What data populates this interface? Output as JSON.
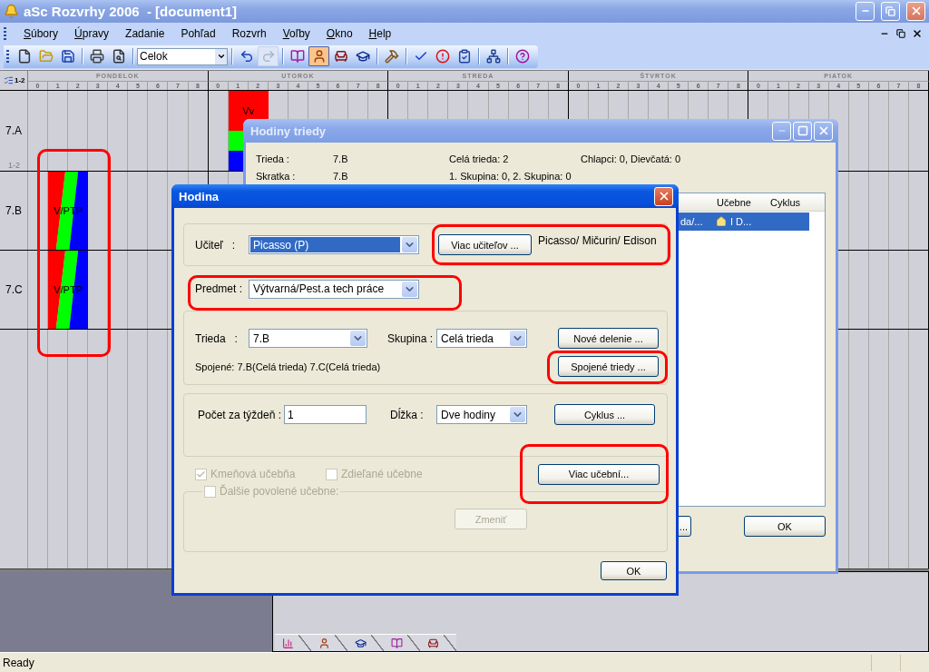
{
  "window": {
    "title": "aSc Rozvrhy 2006  - [document1]"
  },
  "menu": [
    {
      "label": "Súbory",
      "underlined": true
    },
    {
      "label": "Úpravy",
      "underlined": true
    },
    {
      "label": "Zadanie",
      "underlined": false
    },
    {
      "label": "Pohľad",
      "underlined": false
    },
    {
      "label": "Rozvrh",
      "underlined": false
    },
    {
      "label": "Voľby",
      "underlined": true
    },
    {
      "label": "Okno",
      "underlined": true
    },
    {
      "label": "Help",
      "underlined": true
    }
  ],
  "toolbar": {
    "view_select": "Celok",
    "buttons": [
      {
        "pressed": false,
        "disabled": false
      },
      {
        "pressed": false,
        "disabled": false
      },
      {
        "pressed": false,
        "disabled": false
      },
      {
        "pressed": false,
        "disabled": false
      },
      {
        "pressed": false,
        "disabled": false
      },
      {
        "pressed": false,
        "disabled": false
      },
      {
        "pressed": false,
        "disabled": true
      },
      {
        "pressed": false,
        "disabled": false
      },
      {
        "pressed": true,
        "disabled": false
      },
      {
        "pressed": false,
        "disabled": false
      },
      {
        "pressed": false,
        "disabled": false
      },
      {
        "pressed": false,
        "disabled": false
      },
      {
        "pressed": false,
        "disabled": false
      },
      {
        "pressed": false,
        "disabled": false
      },
      {
        "pressed": false,
        "disabled": false
      },
      {
        "pressed": false,
        "disabled": false
      },
      {
        "pressed": false,
        "disabled": false
      }
    ]
  },
  "timetable": {
    "corner_label": "1-2",
    "highlighted": true,
    "days": [
      {
        "name": "PONDELOK",
        "periods": [
          "0",
          "1",
          "2",
          "3",
          "4",
          "5",
          "6",
          "7",
          "8"
        ]
      },
      {
        "name": "UTOROK",
        "periods": [
          "0",
          "1",
          "2",
          "3",
          "4",
          "5",
          "6",
          "7",
          "8"
        ]
      },
      {
        "name": "STREDA",
        "periods": [
          "0",
          "1",
          "2",
          "3",
          "4",
          "5",
          "6",
          "7",
          "8"
        ]
      },
      {
        "name": "ŠTVRTOK",
        "periods": [
          "0",
          "1",
          "2",
          "3",
          "4",
          "5",
          "6",
          "7",
          "8"
        ]
      },
      {
        "name": "PIATOK",
        "periods": [
          "0",
          "1",
          "2",
          "3",
          "4",
          "5",
          "6",
          "7",
          "8"
        ]
      }
    ],
    "rows": [
      {
        "label": "7.A",
        "sublabel": "1-2",
        "segments": [
          {
            "kind": "empty_day"
          },
          {
            "kind": "empty"
          },
          {
            "kind": "stacked",
            "parts": [
              {
                "text": "Vv",
                "color": "#ff0000"
              },
              {
                "color": "#00ff00"
              },
              {
                "color": "#0000ff"
              }
            ]
          }
        ]
      },
      {
        "label": "7.B",
        "segments": [
          {
            "kind": "empty"
          },
          {
            "kind": "striped",
            "text": "V/PTP",
            "parts": [
              {
                "color": "#ff0000"
              },
              {
                "color": "#00ff00"
              },
              {
                "color": "#0000ff"
              }
            ]
          }
        ]
      },
      {
        "label": "7.C",
        "segments": [
          {
            "kind": "empty"
          },
          {
            "kind": "striped",
            "text": "V/PTP",
            "parts": [
              {
                "color": "#ff0000"
              },
              {
                "color": "#00ff00"
              },
              {
                "color": "#0000ff"
              }
            ]
          }
        ]
      }
    ]
  },
  "class_dialog": {
    "title": "Hodiny triedy",
    "info": [
      [
        "Trieda :",
        "7.B",
        "Celá trieda: 2",
        "Chlapci: 0, Dievčatá: 0"
      ],
      [
        "Skratka :",
        "7.B",
        "1. Skupina: 0, 2. Skupina: 0"
      ]
    ],
    "list": {
      "columns": [
        "",
        "Učebne",
        "Cyklus"
      ],
      "rows": [
        {
          "selected": true,
          "cells": [
            "da/...",
            "I D..."
          ]
        }
      ]
    },
    "buttons": [
      "...",
      "OK"
    ]
  },
  "lesson_dialog": {
    "title": "Hodina",
    "teacher": {
      "label": "Učiteľ   :",
      "value": "Picasso (P)",
      "focused": true
    },
    "more_teachers": {
      "label": "Viac učiteľov ...",
      "highlighted": true
    },
    "teachers_text": "Picasso/ Mičurin/ Edison",
    "subject": {
      "label": "Predmet :",
      "value": "Výtvarná/Pest.a tech práce",
      "highlighted": true
    },
    "class": {
      "label": "Trieda   :",
      "value": "7.B"
    },
    "group": {
      "label": "Skupina :",
      "value": "Celá trieda"
    },
    "new_division": {
      "label": "Nové delenie ..."
    },
    "joined_text": "Spojené: 7.B(Celá trieda) 7.C(Celá trieda)",
    "joined_classes": {
      "label": "Spojené triedy ...",
      "highlighted": true
    },
    "count": {
      "label": "Počet za týždeň :",
      "value": "1"
    },
    "length": {
      "label": "Dĺžka :",
      "value": "Dve hodiny"
    },
    "cycle": {
      "label": "Cyklus ..."
    },
    "checkboxes": [
      {
        "label": "Kmeňová učebňa",
        "checked": true,
        "disabled": true
      },
      {
        "label": "Zdieľané učebne",
        "checked": false,
        "disabled": true
      }
    ],
    "more_rooms": {
      "label": "Viac učební...",
      "highlighted": true
    },
    "other_rooms": {
      "label": "Ďalšie povolené učebne:",
      "checked": false,
      "disabled": true
    },
    "change": {
      "label": "Zmeniť",
      "disabled": true
    },
    "ok": {
      "label": "OK"
    }
  },
  "status_bar": {
    "text": "Ready"
  }
}
